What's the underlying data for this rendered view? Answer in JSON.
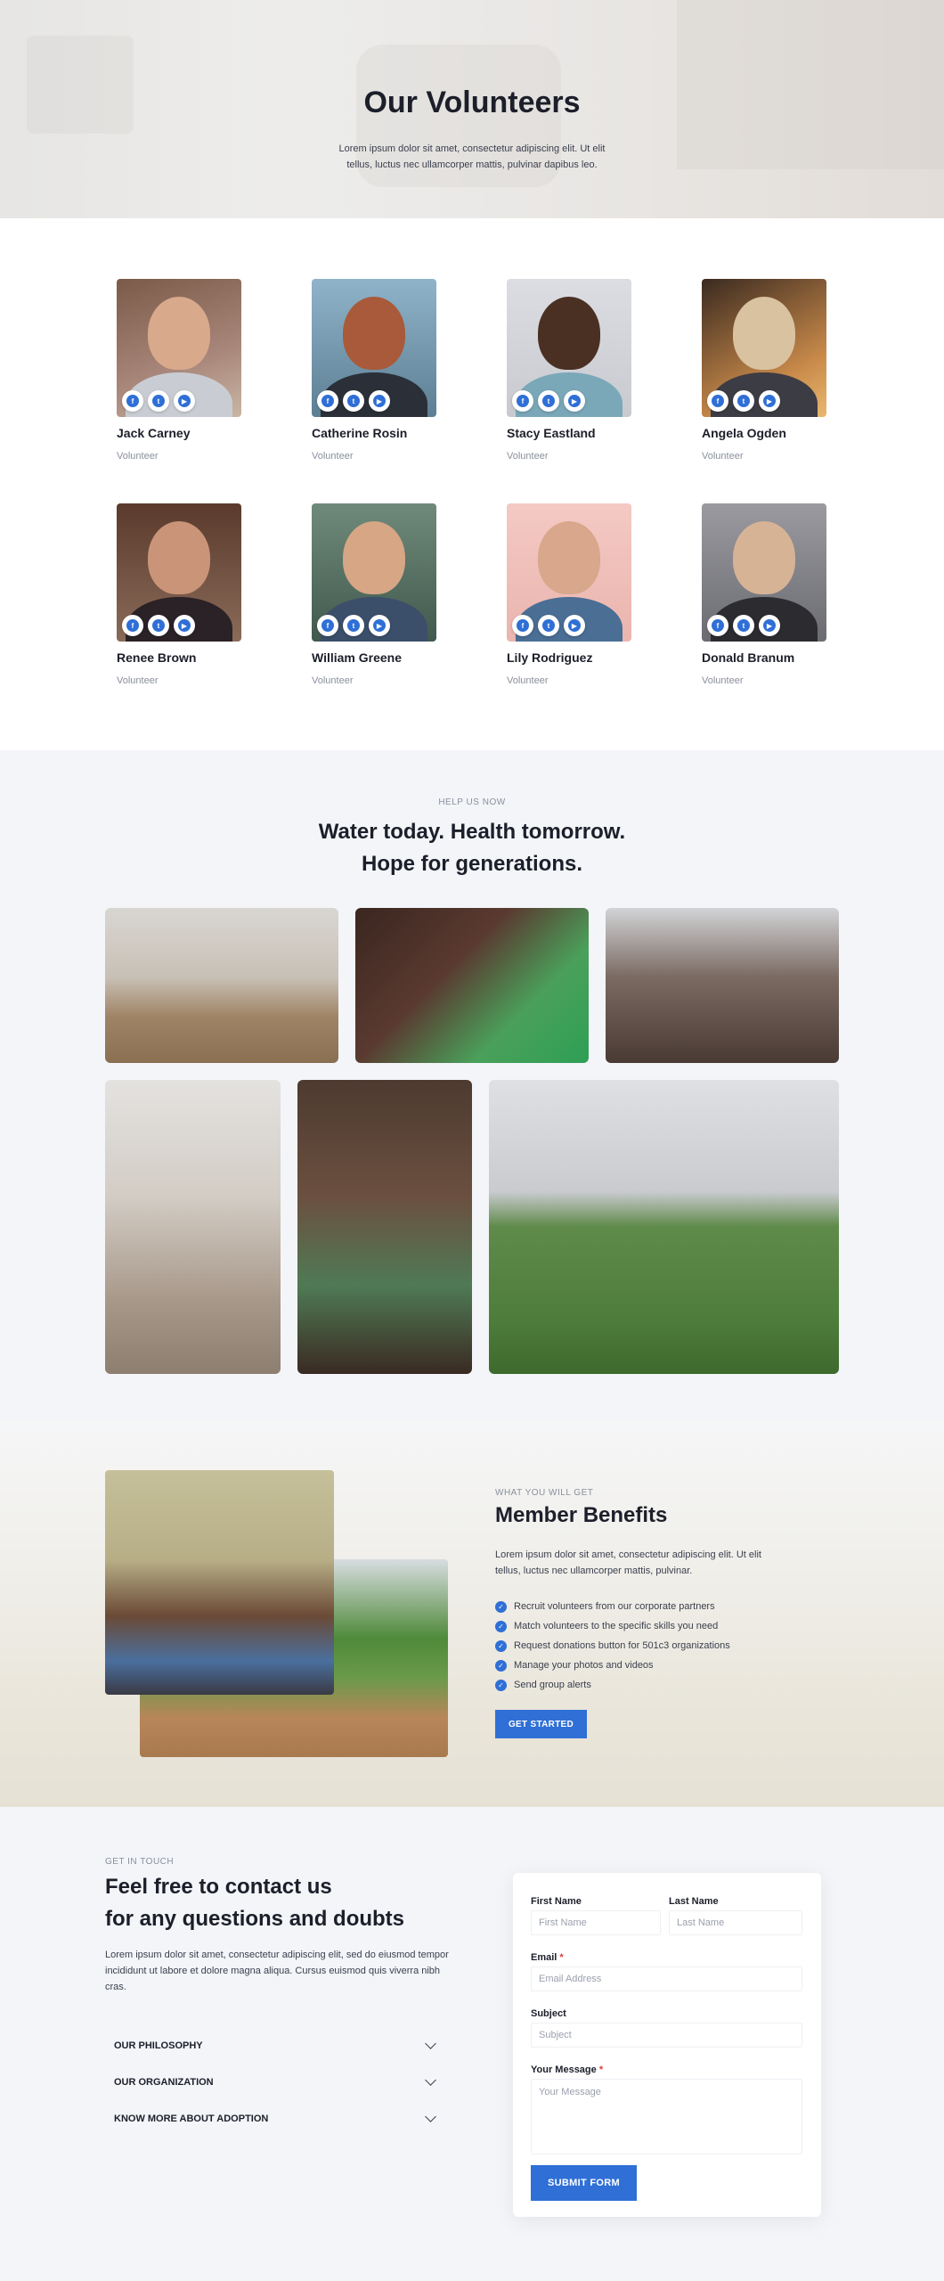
{
  "hero": {
    "title": "Our Volunteers",
    "text": "Lorem ipsum dolor sit amet, consectetur adipiscing elit. Ut elit tellus, luctus nec ullamcorper mattis, pulvinar dapibus leo."
  },
  "volunteers": [
    {
      "name": "Jack Carney",
      "role": "Volunteer"
    },
    {
      "name": "Catherine Rosin",
      "role": "Volunteer"
    },
    {
      "name": "Stacy Eastland",
      "role": "Volunteer"
    },
    {
      "name": "Angela Ogden",
      "role": "Volunteer"
    },
    {
      "name": "Renee Brown",
      "role": "Volunteer"
    },
    {
      "name": "William Greene",
      "role": "Volunteer"
    },
    {
      "name": "Lily Rodriguez",
      "role": "Volunteer"
    },
    {
      "name": "Donald Branum",
      "role": "Volunteer"
    }
  ],
  "social_icons": [
    "facebook-icon",
    "twitter-icon",
    "youtube-icon"
  ],
  "help": {
    "eyebrow": "HELP US NOW",
    "title_line1": "Water today. Health tomorrow.",
    "title_line2": "Hope for generations."
  },
  "benefits": {
    "eyebrow": "WHAT YOU WILL GET",
    "title": "Member Benefits",
    "text": "Lorem ipsum dolor sit amet, consectetur adipiscing elit. Ut elit tellus, luctus nec ullamcorper mattis, pulvinar.",
    "items": [
      "Recruit volunteers from our corporate partners",
      "Match volunteers to the specific skills you need",
      "Request donations button for 501c3 organizations",
      "Manage your photos and videos",
      "Send group alerts"
    ],
    "button": "GET STARTED"
  },
  "contact": {
    "eyebrow": "GET IN TOUCH",
    "title_line1": "Feel free to contact us",
    "title_line2": "for any questions and doubts",
    "text": "Lorem ipsum dolor sit amet, consectetur adipiscing elit, sed do eiusmod tempor incididunt ut labore et dolore magna aliqua. Cursus euismod quis viverra nibh cras.",
    "accordion": [
      "OUR PHILOSOPHY",
      "OUR ORGANIZATION",
      "KNOW MORE ABOUT ADOPTION"
    ]
  },
  "form": {
    "first_name_label": "First Name",
    "first_name_placeholder": "First Name",
    "last_name_label": "Last Name",
    "last_name_placeholder": "Last Name",
    "email_label": "Email",
    "email_placeholder": "Email Address",
    "subject_label": "Subject",
    "subject_placeholder": "Subject",
    "message_label": "Your Message",
    "message_placeholder": "Your Message",
    "required_mark": "*",
    "submit": "SUBMIT FORM"
  },
  "colors": {
    "accent": "#2f6fd6",
    "section_bg": "#f3f5f9",
    "heading": "#1c1f2a"
  }
}
